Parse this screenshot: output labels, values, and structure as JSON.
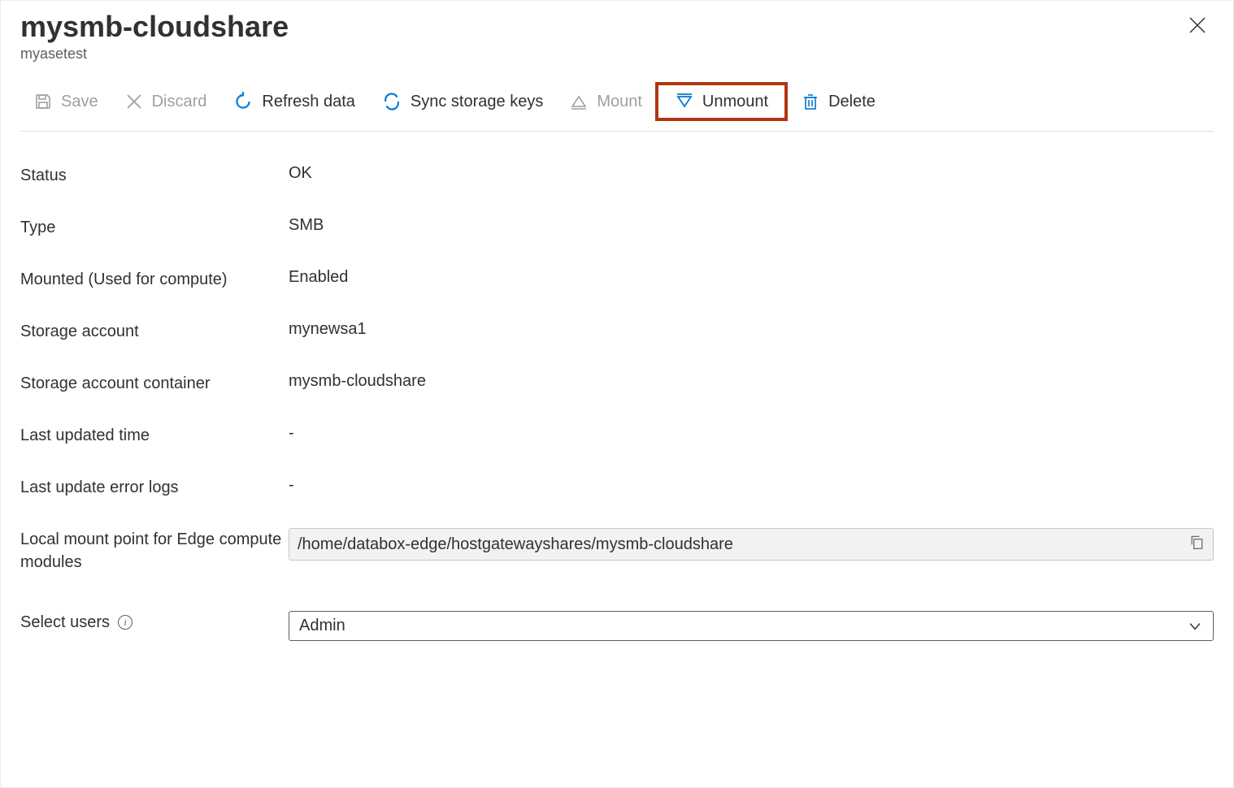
{
  "header": {
    "title": "mysmb-cloudshare",
    "subtitle": "myasetest"
  },
  "toolbar": {
    "save": "Save",
    "discard": "Discard",
    "refresh": "Refresh data",
    "sync": "Sync storage keys",
    "mount": "Mount",
    "unmount": "Unmount",
    "delete": "Delete"
  },
  "fields": {
    "status_label": "Status",
    "status_value": "OK",
    "type_label": "Type",
    "type_value": "SMB",
    "mounted_label": "Mounted (Used for compute)",
    "mounted_value": "Enabled",
    "storage_account_label": "Storage account",
    "storage_account_value": "mynewsa1",
    "container_label": "Storage account container",
    "container_value": "mysmb-cloudshare",
    "last_updated_label": "Last updated time",
    "last_updated_value": "-",
    "error_logs_label": "Last update error logs",
    "error_logs_value": "-",
    "mountpoint_label": "Local mount point for Edge compute modules",
    "mountpoint_value": "/home/databox-edge/hostgatewayshares/mysmb-cloudshare",
    "select_users_label": "Select users",
    "select_users_value": "Admin"
  }
}
